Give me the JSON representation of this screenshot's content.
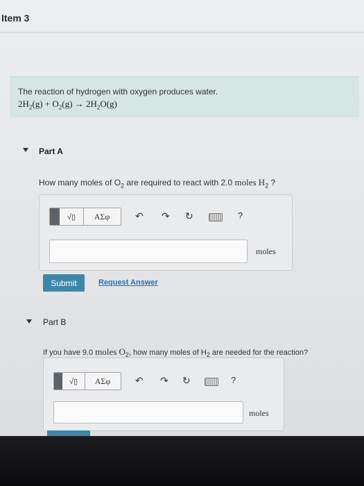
{
  "header": {
    "title": "Item 3"
  },
  "intro": {
    "text": "The reaction of hydrogen with oxygen produces water.",
    "equation": {
      "c1": "2H",
      "s1": "2",
      "p1": "(g) + O",
      "s2": "2",
      "p2": "(g) → 2H",
      "s3": "2",
      "p3": "O(g)"
    }
  },
  "partA": {
    "label": "Part A",
    "question": {
      "pre": "How many moles of O",
      "sub1": "2",
      "mid": " are required to react with 2.0 ",
      "unit": "moles H",
      "sub2": "2",
      "post": " ?"
    },
    "answer_value": "",
    "units": "moles",
    "submit_label": "Submit",
    "request_label": "Request Answer"
  },
  "partB": {
    "label": "Part B",
    "question": {
      "pre": "If you have 9.0 ",
      "unit": "moles O",
      "sub1": "2",
      "mid": ", how many moles of H",
      "sub2": "2",
      "post": " are needed for the reaction?"
    },
    "answer_value": "",
    "units": "moles"
  },
  "toolbar": {
    "math_label": "√▯",
    "greek_label": "ΑΣφ",
    "undo_icon": "↶",
    "redo_icon": "↷",
    "reset_icon": "↻",
    "help_label": "?"
  }
}
